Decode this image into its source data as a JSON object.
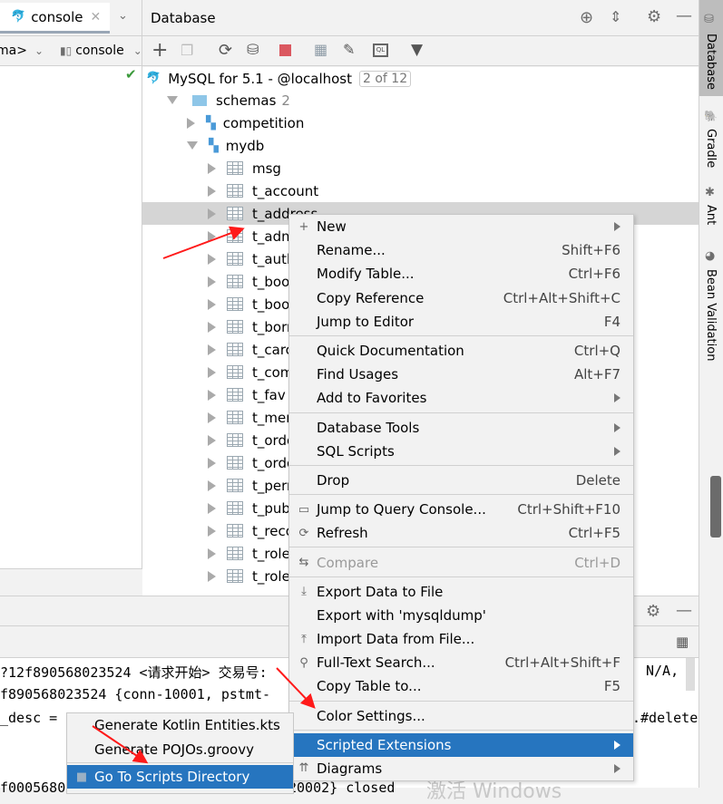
{
  "left_panel": {
    "tab_label": "console",
    "schema_dropdown": "ma>",
    "session_dropdown": "console"
  },
  "database_panel": {
    "title": "Database",
    "connection": {
      "label": "MySQL for 5.1 - @localhost",
      "badge": "2 of 12"
    },
    "schemas": {
      "label": "schemas",
      "count": "2"
    },
    "databases": [
      "competition",
      "mydb"
    ],
    "tables": [
      "msg",
      "t_account",
      "t_address",
      "t_adm",
      "t_auth",
      "t_boo",
      "t_boo",
      "t_borr",
      "t_carc",
      "t_com",
      "t_fav",
      "t_mer",
      "t_ordo",
      "t_ordo",
      "t_perr",
      "t_pub",
      "t_reco",
      "t_role",
      "t_role"
    ]
  },
  "context_menu": [
    {
      "label": "New",
      "shortcut": "",
      "submenu": true,
      "icon": "plus-icon"
    },
    {
      "label": "Rename...",
      "shortcut": "Shift+F6"
    },
    {
      "label": "Modify Table...",
      "shortcut": "Ctrl+F6"
    },
    {
      "label": "Copy Reference",
      "shortcut": "Ctrl+Alt+Shift+C"
    },
    {
      "label": "Jump to Editor",
      "shortcut": "F4"
    },
    {
      "label": "Quick Documentation",
      "shortcut": "Ctrl+Q"
    },
    {
      "label": "Find Usages",
      "shortcut": "Alt+F7"
    },
    {
      "label": "Add to Favorites",
      "shortcut": "",
      "submenu": true
    },
    {
      "label": "Database Tools",
      "shortcut": "",
      "submenu": true
    },
    {
      "label": "SQL Scripts",
      "shortcut": "",
      "submenu": true
    },
    {
      "label": "Drop",
      "shortcut": "Delete"
    },
    {
      "label": "Jump to Query Console...",
      "shortcut": "Ctrl+Shift+F10",
      "icon": "ql-icon"
    },
    {
      "label": "Refresh",
      "shortcut": "Ctrl+F5",
      "icon": "refresh-icon"
    },
    {
      "label": "Compare",
      "shortcut": "Ctrl+D",
      "disabled": true,
      "icon": "compare-icon"
    },
    {
      "label": "Export Data to File",
      "shortcut": "",
      "icon": "export-icon"
    },
    {
      "label": "Export with 'mysqldump'",
      "shortcut": ""
    },
    {
      "label": "Import Data from File...",
      "shortcut": "",
      "icon": "import-icon"
    },
    {
      "label": "Full-Text Search...",
      "shortcut": "Ctrl+Alt+Shift+F",
      "icon": "search-icon"
    },
    {
      "label": "Copy Table to...",
      "shortcut": "F5"
    },
    {
      "label": "Color Settings...",
      "shortcut": ""
    },
    {
      "label": "Scripted Extensions",
      "shortcut": "",
      "submenu": true,
      "highlighted": true
    },
    {
      "label": "Diagrams",
      "shortcut": "",
      "submenu": true,
      "icon": "diagram-icon"
    }
  ],
  "submenu": [
    "Generate Kotlin Entities.kts",
    "Generate POJOs.groovy",
    "Go To Scripts Directory"
  ],
  "console_lines": {
    "l1": "?12f890568023524 <请求开始> 交易号:",
    "l1_right": "N/A,",
    "l2": "f890568023524 {conn-10001, pstmt-",
    "l3": "_desc = ",
    "l3_right": ".#delete",
    "l4": "f0005680",
    "l4_right": "20002} closed",
    "watermark": "激活 Windows"
  },
  "right_strip": [
    "Database",
    "Gradle",
    "Ant",
    "Bean Validation"
  ],
  "colors": {
    "accent": "#2675bf",
    "selection": "#d5d5d5",
    "arrow": "#ff1a1a"
  }
}
